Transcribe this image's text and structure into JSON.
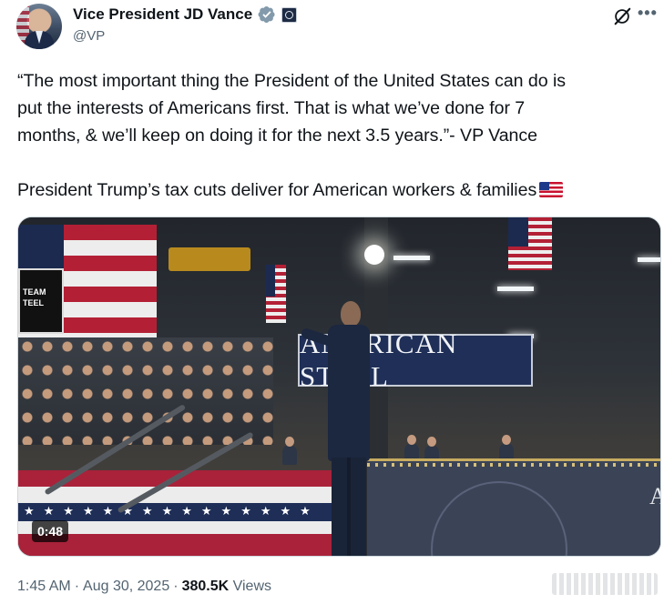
{
  "author": {
    "display_name": "Vice President JD Vance",
    "handle": "@VP",
    "verified_icon": "verified-badge-icon",
    "affiliation_icon": "vp-seal-badge-icon"
  },
  "actions": {
    "grok_icon": "grok-icon",
    "more_label": "•••"
  },
  "tweet": {
    "lines": [
      "“The most important thing the President of the United States can do is",
      "put the interests of Americans first. That is what we’ve done for 7",
      "months, & we’ll keep on doing it for the next 3.5 years.”- VP Vance"
    ],
    "second_paragraph": "President Trump’s tax cuts deliver for American workers & families",
    "flag_emoji": "us-flag-emoji"
  },
  "media": {
    "type": "video",
    "duration": "0:48",
    "banner_text": "AMERICAN STEEL",
    "sign_text_1": "TEAM",
    "sign_text_2": "TEEL",
    "podium_text": "A"
  },
  "meta": {
    "time": "1:45 AM",
    "separator": "·",
    "date": "Aug 30, 2025",
    "views_count": "380.5K",
    "views_label": "Views"
  },
  "colors": {
    "text_primary": "#0f1419",
    "text_secondary": "#536471",
    "verified_blue": "#1d9bf0"
  }
}
